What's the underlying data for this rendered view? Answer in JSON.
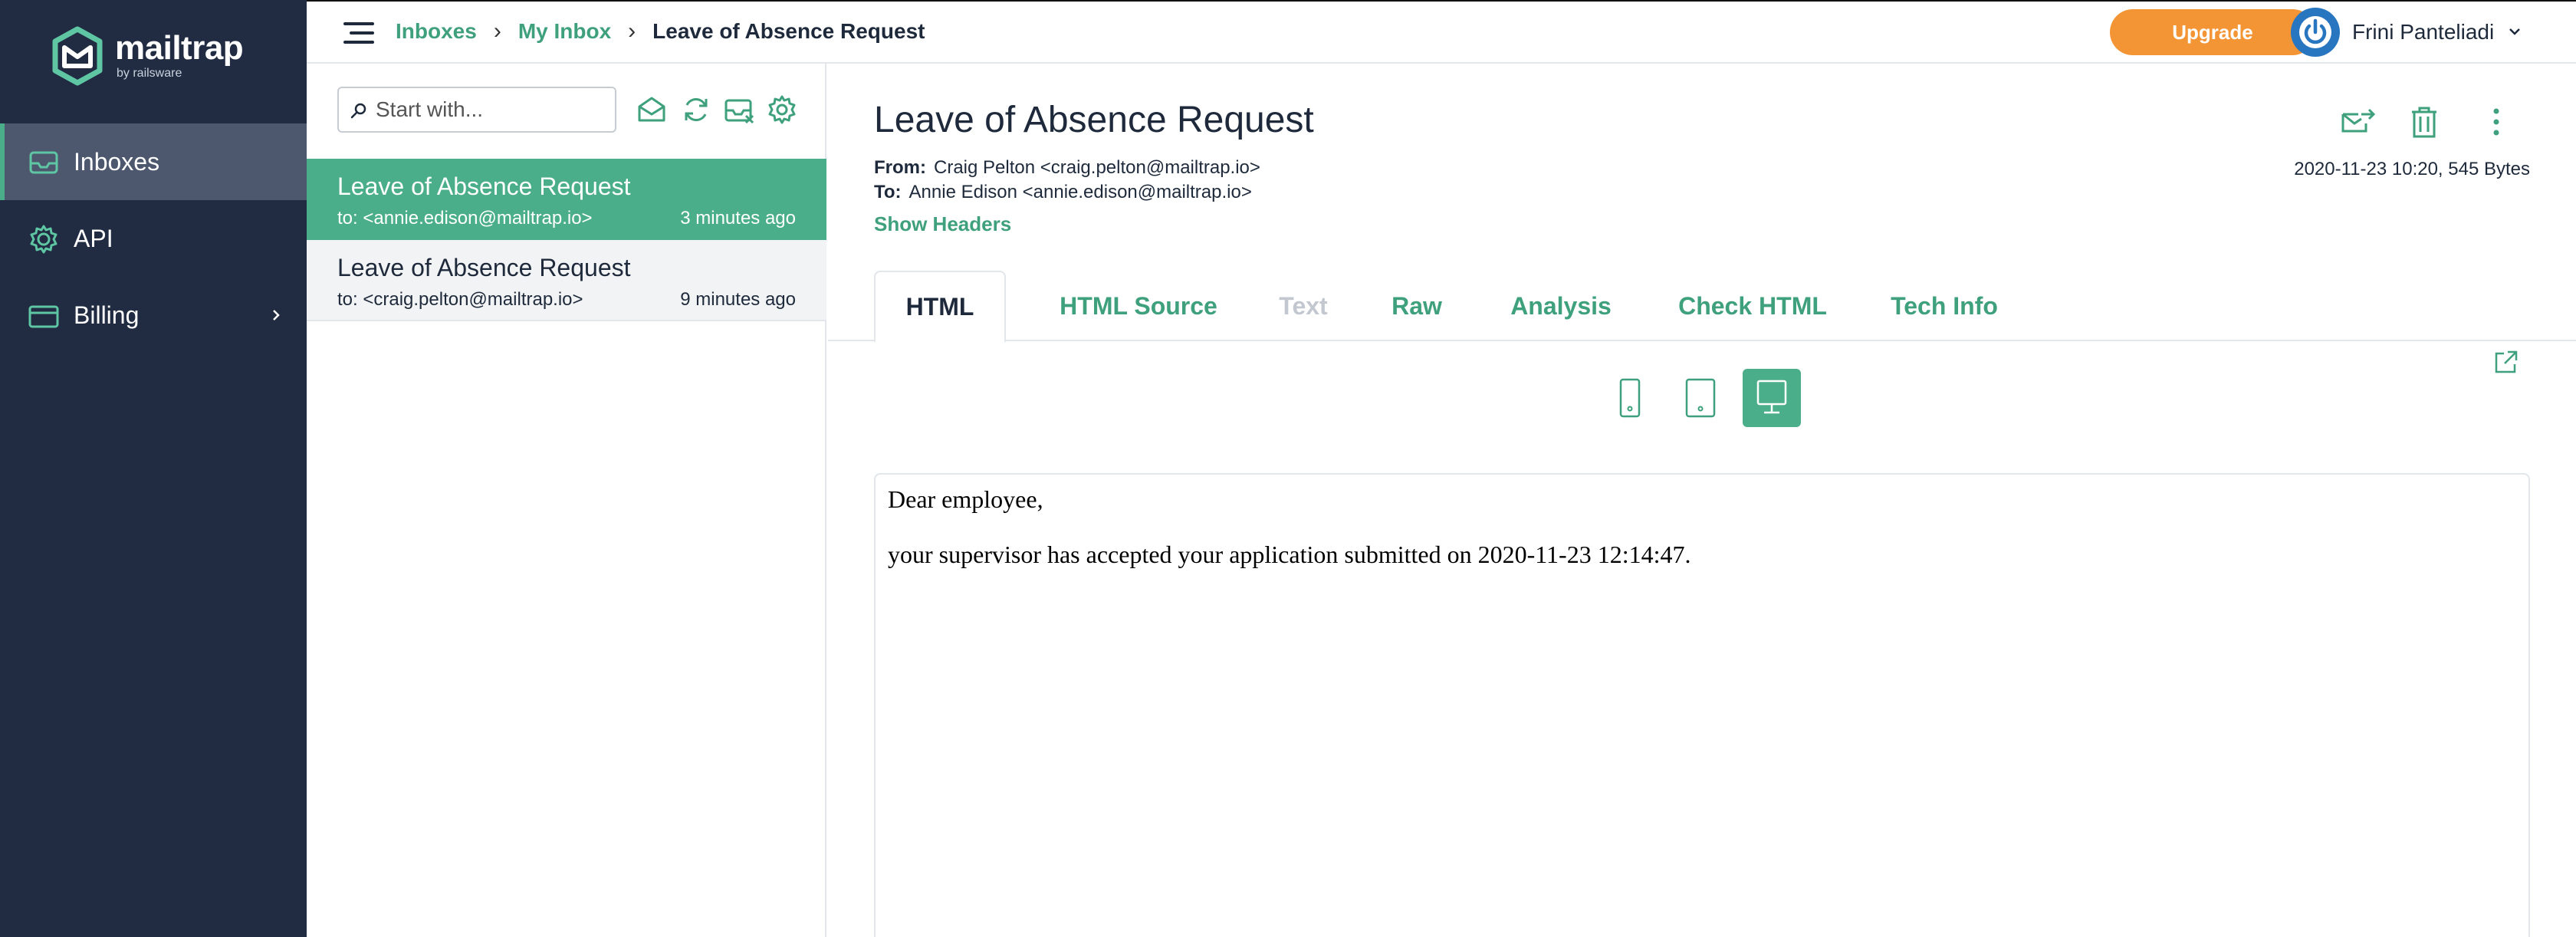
{
  "brand": {
    "name": "mailtrap",
    "tagline": "by railsware",
    "accent": "#4aae8b",
    "sidebar_bg": "#212c43"
  },
  "sidebar": {
    "items": [
      {
        "label": "Inboxes",
        "icon": "inbox-icon",
        "active": true
      },
      {
        "label": "API",
        "icon": "gear-icon"
      },
      {
        "label": "Billing",
        "icon": "card-icon",
        "has_submenu": true
      }
    ]
  },
  "header": {
    "breadcrumb": [
      "Inboxes",
      "My Inbox",
      "Leave of Absence Request"
    ],
    "upgrade_label": "Upgrade",
    "upgrade_color": "#f39535",
    "user_name": "Frini Panteliadi"
  },
  "list": {
    "search_placeholder": "Start with...",
    "messages": [
      {
        "subject": "Leave of Absence Request",
        "to": "to: <annie.edison@mailtrap.io>",
        "time": "3 minutes ago",
        "selected": true
      },
      {
        "subject": "Leave of Absence Request",
        "to": "to: <craig.pelton@mailtrap.io>",
        "time": "9 minutes ago",
        "selected": false
      }
    ]
  },
  "message": {
    "subject": "Leave of Absence Request",
    "from_label": "From:",
    "from_value": "Craig Pelton <craig.pelton@mailtrap.io>",
    "to_label": "To:",
    "to_value": "Annie Edison <annie.edison@mailtrap.io>",
    "date_size": "2020-11-23 10:20, 545 Bytes",
    "show_headers": "Show Headers",
    "tabs": [
      {
        "label": "HTML",
        "state": "active"
      },
      {
        "label": "HTML Source",
        "state": "normal"
      },
      {
        "label": "Text",
        "state": "disabled"
      },
      {
        "label": "Raw",
        "state": "normal"
      },
      {
        "label": "Analysis",
        "state": "normal"
      },
      {
        "label": "Check HTML",
        "state": "normal"
      },
      {
        "label": "Tech Info",
        "state": "normal"
      }
    ],
    "view_mode": "desktop",
    "body": {
      "line1": "Dear employee,",
      "line2": "your supervisor has accepted your application submitted on 2020-11-23 12:14:47."
    }
  }
}
